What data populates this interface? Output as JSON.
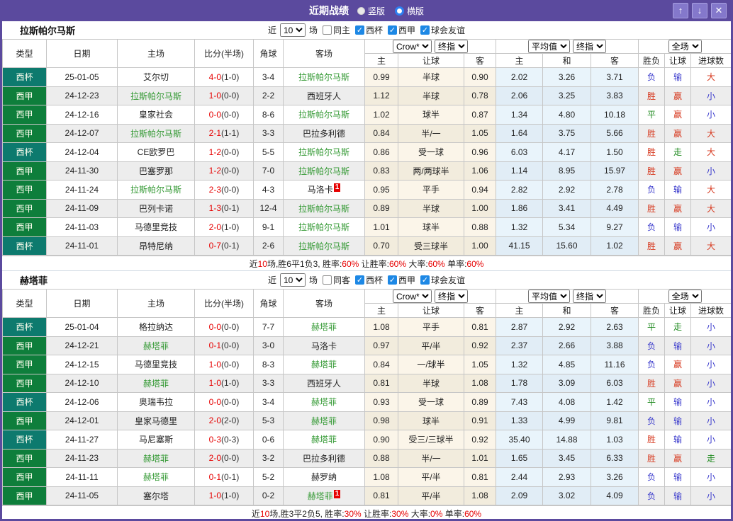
{
  "title_bar": {
    "title": "近期战绩",
    "radio_options": [
      {
        "label": "竖版",
        "selected": false
      },
      {
        "label": "横版",
        "selected": true
      }
    ],
    "window_buttons": {
      "up": "↑",
      "down": "↓",
      "close": "✕"
    }
  },
  "colors": {
    "accent_purple": "#5b4a9e",
    "cup_bg": "#0d7a6e",
    "liga_bg": "#0e7e3b",
    "highlight_team_green": "#339933",
    "score_red": "#e60000",
    "result_red": "#d73a20",
    "result_blue": "#3939cc",
    "result_green": "#1f8a1f",
    "crow_col_bg": "#fbf5e9",
    "avg_col_bg": "#e9f4fb",
    "checkbox_blue": "#1d88e5"
  },
  "filter_common": {
    "near": "近",
    "matches": "10",
    "games": "场",
    "leagues": [
      "西杯",
      "西甲",
      "球会友谊"
    ]
  },
  "header": {
    "type": "类型",
    "date": "日期",
    "home": "主场",
    "score": "比分(半场)",
    "corner": "角球",
    "away": "客场",
    "crow_dd": "Crow*",
    "final_dd": "终指",
    "avg_dd": "平均值",
    "full_dd": "全场",
    "sub_home": "主",
    "sub_handicap": "让球",
    "sub_away": "客",
    "sub_avg_home": "主",
    "sub_avg_draw": "和",
    "sub_avg_away": "客",
    "sub_wdl": "胜负",
    "sub_handicap_res": "让球",
    "sub_goals": "进球数"
  },
  "sections": [
    {
      "team": "拉斯帕尔马斯",
      "same_filter": "同主",
      "rows": [
        {
          "lg": "西杯",
          "lgc": "cup",
          "date": "25-01-05",
          "home": "艾尔切",
          "hhl": false,
          "hbadge": "",
          "score": "4-0",
          "half": "(1-0)",
          "cor": "3-4",
          "away": "拉斯帕尔马斯",
          "ahl": true,
          "abadge": "",
          "c1": "0.99",
          "c2": "半球",
          "c3": "0.90",
          "a1": "2.02",
          "a2": "3.26",
          "a3": "3.71",
          "r1": "负",
          "r1c": "b",
          "r2": "输",
          "r2c": "b",
          "r3": "大",
          "r3c": "r"
        },
        {
          "lg": "西甲",
          "lgc": "liga",
          "date": "24-12-23",
          "home": "拉斯帕尔马斯",
          "hhl": true,
          "hbadge": "",
          "score": "1-0",
          "half": "(0-0)",
          "cor": "2-2",
          "away": "西班牙人",
          "ahl": false,
          "abadge": "",
          "c1": "1.12",
          "c2": "半球",
          "c3": "0.78",
          "a1": "2.06",
          "a2": "3.25",
          "a3": "3.83",
          "r1": "胜",
          "r1c": "r",
          "r2": "赢",
          "r2c": "r",
          "r3": "小",
          "r3c": "b"
        },
        {
          "lg": "西甲",
          "lgc": "liga",
          "date": "24-12-16",
          "home": "皇家社会",
          "hhl": false,
          "hbadge": "",
          "score": "0-0",
          "half": "(0-0)",
          "cor": "8-6",
          "away": "拉斯帕尔马斯",
          "ahl": true,
          "abadge": "",
          "c1": "1.02",
          "c2": "球半",
          "c3": "0.87",
          "a1": "1.34",
          "a2": "4.80",
          "a3": "10.18",
          "r1": "平",
          "r1c": "g",
          "r2": "赢",
          "r2c": "r",
          "r3": "小",
          "r3c": "b"
        },
        {
          "lg": "西甲",
          "lgc": "liga",
          "date": "24-12-07",
          "home": "拉斯帕尔马斯",
          "hhl": true,
          "hbadge": "",
          "score": "2-1",
          "half": "(1-1)",
          "cor": "3-3",
          "away": "巴拉多利德",
          "ahl": false,
          "abadge": "",
          "c1": "0.84",
          "c2": "半/一",
          "c3": "1.05",
          "a1": "1.64",
          "a2": "3.75",
          "a3": "5.66",
          "r1": "胜",
          "r1c": "r",
          "r2": "赢",
          "r2c": "r",
          "r3": "大",
          "r3c": "r"
        },
        {
          "lg": "西杯",
          "lgc": "cup",
          "date": "24-12-04",
          "home": "CE欧罗巴",
          "hhl": false,
          "hbadge": "",
          "score": "1-2",
          "half": "(0-0)",
          "cor": "5-5",
          "away": "拉斯帕尔马斯",
          "ahl": true,
          "abadge": "",
          "c1": "0.86",
          "c2": "受一球",
          "c3": "0.96",
          "a1": "6.03",
          "a2": "4.17",
          "a3": "1.50",
          "r1": "胜",
          "r1c": "r",
          "r2": "走",
          "r2c": "g",
          "r3": "大",
          "r3c": "r"
        },
        {
          "lg": "西甲",
          "lgc": "liga",
          "date": "24-11-30",
          "home": "巴塞罗那",
          "hhl": false,
          "hbadge": "",
          "score": "1-2",
          "half": "(0-0)",
          "cor": "7-0",
          "away": "拉斯帕尔马斯",
          "ahl": true,
          "abadge": "",
          "c1": "0.83",
          "c2": "两/两球半",
          "c3": "1.06",
          "a1": "1.14",
          "a2": "8.95",
          "a3": "15.97",
          "r1": "胜",
          "r1c": "r",
          "r2": "赢",
          "r2c": "r",
          "r3": "小",
          "r3c": "b"
        },
        {
          "lg": "西甲",
          "lgc": "liga",
          "date": "24-11-24",
          "home": "拉斯帕尔马斯",
          "hhl": true,
          "hbadge": "",
          "score": "2-3",
          "half": "(0-0)",
          "cor": "4-3",
          "away": "马洛卡",
          "ahl": false,
          "abadge": "1",
          "c1": "0.95",
          "c2": "平手",
          "c3": "0.94",
          "a1": "2.82",
          "a2": "2.92",
          "a3": "2.78",
          "r1": "负",
          "r1c": "b",
          "r2": "输",
          "r2c": "b",
          "r3": "大",
          "r3c": "r"
        },
        {
          "lg": "西甲",
          "lgc": "liga",
          "date": "24-11-09",
          "home": "巴列卡诺",
          "hhl": false,
          "hbadge": "",
          "score": "1-3",
          "half": "(0-1)",
          "cor": "12-4",
          "away": "拉斯帕尔马斯",
          "ahl": true,
          "abadge": "",
          "c1": "0.89",
          "c2": "半球",
          "c3": "1.00",
          "a1": "1.86",
          "a2": "3.41",
          "a3": "4.49",
          "r1": "胜",
          "r1c": "r",
          "r2": "赢",
          "r2c": "r",
          "r3": "大",
          "r3c": "r"
        },
        {
          "lg": "西甲",
          "lgc": "liga",
          "date": "24-11-03",
          "home": "马德里竞技",
          "hhl": false,
          "hbadge": "",
          "score": "2-0",
          "half": "(1-0)",
          "cor": "9-1",
          "away": "拉斯帕尔马斯",
          "ahl": true,
          "abadge": "",
          "c1": "1.01",
          "c2": "球半",
          "c3": "0.88",
          "a1": "1.32",
          "a2": "5.34",
          "a3": "9.27",
          "r1": "负",
          "r1c": "b",
          "r2": "输",
          "r2c": "b",
          "r3": "小",
          "r3c": "b"
        },
        {
          "lg": "西杯",
          "lgc": "cup",
          "date": "24-11-01",
          "home": "昂特尼纳",
          "hhl": false,
          "hbadge": "",
          "score": "0-7",
          "half": "(0-1)",
          "cor": "2-6",
          "away": "拉斯帕尔马斯",
          "ahl": true,
          "abadge": "",
          "c1": "0.70",
          "c2": "受三球半",
          "c3": "1.00",
          "a1": "41.15",
          "a2": "15.60",
          "a3": "1.02",
          "r1": "胜",
          "r1c": "r",
          "r2": "赢",
          "r2c": "r",
          "r3": "大",
          "r3c": "r"
        }
      ],
      "summary": [
        {
          "t": "近"
        },
        {
          "t": "10",
          "c": "r"
        },
        {
          "t": "场,胜6平1负3, 胜率:"
        },
        {
          "t": "60%",
          "c": "r"
        },
        {
          "t": " 让胜率:"
        },
        {
          "t": "60%",
          "c": "r"
        },
        {
          "t": " 大率:"
        },
        {
          "t": "60%",
          "c": "r"
        },
        {
          "t": " 单率:"
        },
        {
          "t": "60%",
          "c": "r"
        }
      ]
    },
    {
      "team": "赫塔菲",
      "same_filter": "同客",
      "rows": [
        {
          "lg": "西杯",
          "lgc": "cup",
          "date": "25-01-04",
          "home": "格拉纳达",
          "hhl": false,
          "hbadge": "",
          "score": "0-0",
          "half": "(0-0)",
          "cor": "7-7",
          "away": "赫塔菲",
          "ahl": true,
          "abadge": "",
          "c1": "1.08",
          "c2": "平手",
          "c3": "0.81",
          "a1": "2.87",
          "a2": "2.92",
          "a3": "2.63",
          "r1": "平",
          "r1c": "g",
          "r2": "走",
          "r2c": "g",
          "r3": "小",
          "r3c": "b"
        },
        {
          "lg": "西甲",
          "lgc": "liga",
          "date": "24-12-21",
          "home": "赫塔菲",
          "hhl": true,
          "hbadge": "",
          "score": "0-1",
          "half": "(0-0)",
          "cor": "3-0",
          "away": "马洛卡",
          "ahl": false,
          "abadge": "",
          "c1": "0.97",
          "c2": "平/半",
          "c3": "0.92",
          "a1": "2.37",
          "a2": "2.66",
          "a3": "3.88",
          "r1": "负",
          "r1c": "b",
          "r2": "输",
          "r2c": "b",
          "r3": "小",
          "r3c": "b"
        },
        {
          "lg": "西甲",
          "lgc": "liga",
          "date": "24-12-15",
          "home": "马德里竞技",
          "hhl": false,
          "hbadge": "",
          "score": "1-0",
          "half": "(0-0)",
          "cor": "8-3",
          "away": "赫塔菲",
          "ahl": true,
          "abadge": "",
          "c1": "0.84",
          "c2": "一/球半",
          "c3": "1.05",
          "a1": "1.32",
          "a2": "4.85",
          "a3": "11.16",
          "r1": "负",
          "r1c": "b",
          "r2": "赢",
          "r2c": "r",
          "r3": "小",
          "r3c": "b"
        },
        {
          "lg": "西甲",
          "lgc": "liga",
          "date": "24-12-10",
          "home": "赫塔菲",
          "hhl": true,
          "hbadge": "",
          "score": "1-0",
          "half": "(1-0)",
          "cor": "3-3",
          "away": "西班牙人",
          "ahl": false,
          "abadge": "",
          "c1": "0.81",
          "c2": "半球",
          "c3": "1.08",
          "a1": "1.78",
          "a2": "3.09",
          "a3": "6.03",
          "r1": "胜",
          "r1c": "r",
          "r2": "赢",
          "r2c": "r",
          "r3": "小",
          "r3c": "b"
        },
        {
          "lg": "西杯",
          "lgc": "cup",
          "date": "24-12-06",
          "home": "奥瑞韦拉",
          "hhl": false,
          "hbadge": "",
          "score": "0-0",
          "half": "(0-0)",
          "cor": "3-4",
          "away": "赫塔菲",
          "ahl": true,
          "abadge": "",
          "c1": "0.93",
          "c2": "受一球",
          "c3": "0.89",
          "a1": "7.43",
          "a2": "4.08",
          "a3": "1.42",
          "r1": "平",
          "r1c": "g",
          "r2": "输",
          "r2c": "b",
          "r3": "小",
          "r3c": "b"
        },
        {
          "lg": "西甲",
          "lgc": "liga",
          "date": "24-12-01",
          "home": "皇家马德里",
          "hhl": false,
          "hbadge": "",
          "score": "2-0",
          "half": "(2-0)",
          "cor": "5-3",
          "away": "赫塔菲",
          "ahl": true,
          "abadge": "",
          "c1": "0.98",
          "c2": "球半",
          "c3": "0.91",
          "a1": "1.33",
          "a2": "4.99",
          "a3": "9.81",
          "r1": "负",
          "r1c": "b",
          "r2": "输",
          "r2c": "b",
          "r3": "小",
          "r3c": "b"
        },
        {
          "lg": "西杯",
          "lgc": "cup",
          "date": "24-11-27",
          "home": "马尼塞斯",
          "hhl": false,
          "hbadge": "",
          "score": "0-3",
          "half": "(0-3)",
          "cor": "0-6",
          "away": "赫塔菲",
          "ahl": true,
          "abadge": "",
          "c1": "0.90",
          "c2": "受三/三球半",
          "c3": "0.92",
          "a1": "35.40",
          "a2": "14.88",
          "a3": "1.03",
          "r1": "胜",
          "r1c": "r",
          "r2": "输",
          "r2c": "b",
          "r3": "小",
          "r3c": "b"
        },
        {
          "lg": "西甲",
          "lgc": "liga",
          "date": "24-11-23",
          "home": "赫塔菲",
          "hhl": true,
          "hbadge": "",
          "score": "2-0",
          "half": "(0-0)",
          "cor": "3-2",
          "away": "巴拉多利德",
          "ahl": false,
          "abadge": "",
          "c1": "0.88",
          "c2": "半/一",
          "c3": "1.01",
          "a1": "1.65",
          "a2": "3.45",
          "a3": "6.33",
          "r1": "胜",
          "r1c": "r",
          "r2": "赢",
          "r2c": "r",
          "r3": "走",
          "r3c": "g"
        },
        {
          "lg": "西甲",
          "lgc": "liga",
          "date": "24-11-11",
          "home": "赫塔菲",
          "hhl": true,
          "hbadge": "",
          "score": "0-1",
          "half": "(0-1)",
          "cor": "5-2",
          "away": "赫罗纳",
          "ahl": false,
          "abadge": "",
          "c1": "1.08",
          "c2": "平/半",
          "c3": "0.81",
          "a1": "2.44",
          "a2": "2.93",
          "a3": "3.26",
          "r1": "负",
          "r1c": "b",
          "r2": "输",
          "r2c": "b",
          "r3": "小",
          "r3c": "b"
        },
        {
          "lg": "西甲",
          "lgc": "liga",
          "date": "24-11-05",
          "home": "塞尔塔",
          "hhl": false,
          "hbadge": "",
          "score": "1-0",
          "half": "(1-0)",
          "cor": "0-2",
          "away": "赫塔菲",
          "ahl": true,
          "abadge": "1",
          "c1": "0.81",
          "c2": "平/半",
          "c3": "1.08",
          "a1": "2.09",
          "a2": "3.02",
          "a3": "4.09",
          "r1": "负",
          "r1c": "b",
          "r2": "输",
          "r2c": "b",
          "r3": "小",
          "r3c": "b"
        }
      ],
      "summary": [
        {
          "t": "近"
        },
        {
          "t": "10",
          "c": "r"
        },
        {
          "t": "场,胜3平2负5, 胜率:"
        },
        {
          "t": "30%",
          "c": "r"
        },
        {
          "t": " 让胜率:"
        },
        {
          "t": "30%",
          "c": "r"
        },
        {
          "t": " 大率:"
        },
        {
          "t": "0%",
          "c": "r"
        },
        {
          "t": " 单率:"
        },
        {
          "t": "60%",
          "c": "r"
        }
      ]
    }
  ]
}
